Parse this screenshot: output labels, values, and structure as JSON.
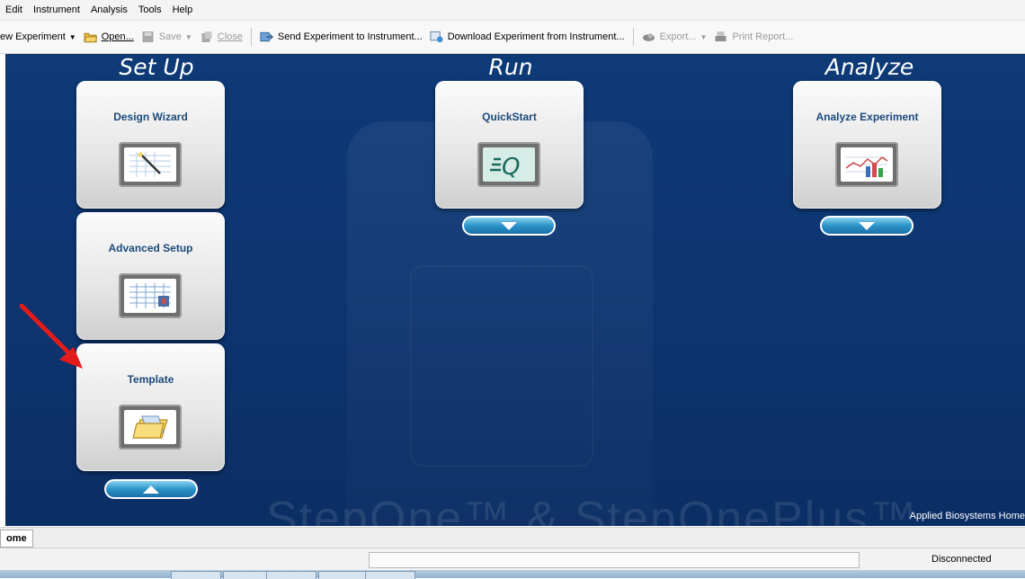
{
  "menubar": {
    "items": [
      "Edit",
      "Instrument",
      "Analysis",
      "Tools",
      "Help"
    ]
  },
  "toolbar": {
    "new_experiment": "ew Experiment",
    "open": "Open...",
    "save": "Save",
    "close": "Close",
    "send": "Send Experiment to Instrument...",
    "download": "Download Experiment from Instrument...",
    "export": "Export...",
    "print_report": "Print Report..."
  },
  "sections": {
    "setup": {
      "title": "Set Up",
      "design_wizard": "Design Wizard",
      "advanced_setup": "Advanced Setup",
      "template": "Template"
    },
    "run": {
      "title": "Run",
      "quickstart": "QuickStart"
    },
    "analyze": {
      "title": "Analyze",
      "analyze_experiment": "Analyze Experiment"
    }
  },
  "watermark": "StepOne™ & StepOnePlus™",
  "brand": "Applied Biosystems Home",
  "tabs": {
    "home": "ome"
  },
  "status": {
    "connection": "Disconnected"
  },
  "colors": {
    "background": "#0d3570",
    "pill": "#2a93c9",
    "card_label": "#1b4a7a",
    "arrow": "#e21b1b"
  },
  "icons": [
    "open-folder-icon",
    "save-icon",
    "close-icon",
    "send-icon",
    "download-icon",
    "export-icon",
    "print-icon",
    "wand-icon",
    "quickstart-q-icon",
    "chart-icon",
    "grid-icon",
    "folder-icon"
  ]
}
